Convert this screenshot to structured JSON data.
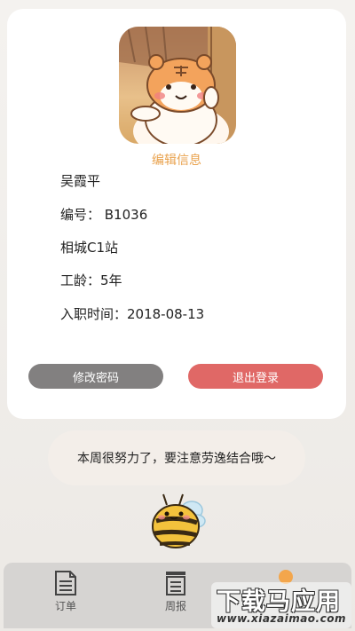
{
  "profile": {
    "edit_label": "编辑信息",
    "name": "吴霞平",
    "id_line": "编号：  B1036",
    "station": "相城C1站",
    "seniority_line": "工龄：5年",
    "hire_date_line": "入职时间：2018-08-13"
  },
  "buttons": {
    "change_password": "修改密码",
    "logout": "退出登录"
  },
  "encouragement": "本周很努力了，要注意劳逸结合哦～",
  "tabbar": {
    "tabs": [
      {
        "label": "订单",
        "icon": "document-icon"
      },
      {
        "label": "周报",
        "icon": "report-icon"
      }
    ]
  },
  "watermark": {
    "title": "下载马应用",
    "url": "www.xiazaimao.com"
  },
  "colors": {
    "accent": "#e9a24d",
    "logout": "#e06866",
    "secondary_button": "#828080"
  }
}
